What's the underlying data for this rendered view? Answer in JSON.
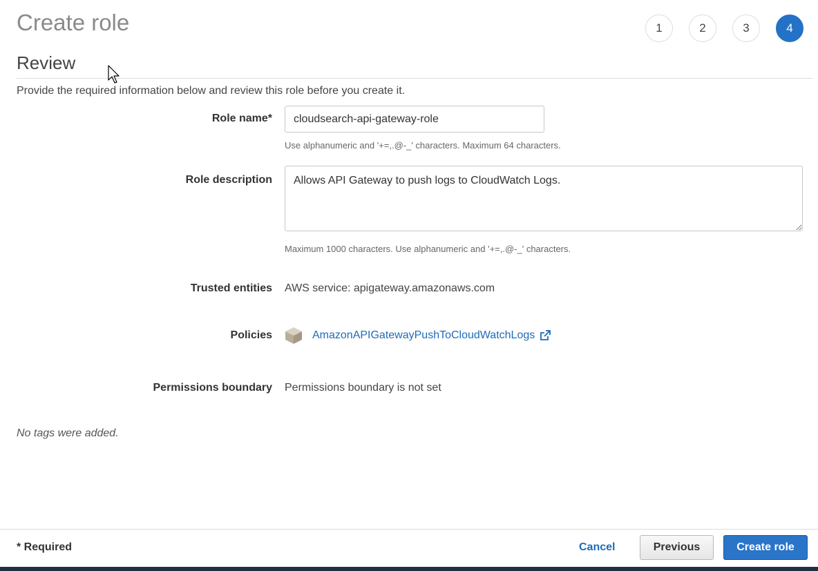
{
  "header": {
    "title": "Create role",
    "steps": [
      "1",
      "2",
      "3",
      "4"
    ],
    "active_step": "4"
  },
  "section": {
    "title": "Review",
    "intro": "Provide the required information below and review this role before you create it."
  },
  "form": {
    "role_name_label": "Role name*",
    "role_name_value": "cloudsearch-api-gateway-role",
    "role_name_hint": "Use alphanumeric and '+=,.@-_' characters. Maximum 64 characters.",
    "role_description_label": "Role description",
    "role_description_value": "Allows API Gateway to push logs to CloudWatch Logs.",
    "role_description_hint": "Maximum 1000 characters. Use alphanumeric and '+=,.@-_' characters.",
    "trusted_entities_label": "Trusted entities",
    "trusted_entities_value": "AWS service: apigateway.amazonaws.com",
    "policies_label": "Policies",
    "policy_name": "AmazonAPIGatewayPushToCloudWatchLogs",
    "permissions_boundary_label": "Permissions boundary",
    "permissions_boundary_value": "Permissions boundary is not set",
    "tags_note": "No tags were added."
  },
  "footer": {
    "required_note": "* Required",
    "cancel_label": "Cancel",
    "previous_label": "Previous",
    "create_label": "Create role"
  },
  "colors": {
    "accent": "#2372c7",
    "link": "#1f6bb8",
    "title_gray": "#8a8a8a"
  }
}
